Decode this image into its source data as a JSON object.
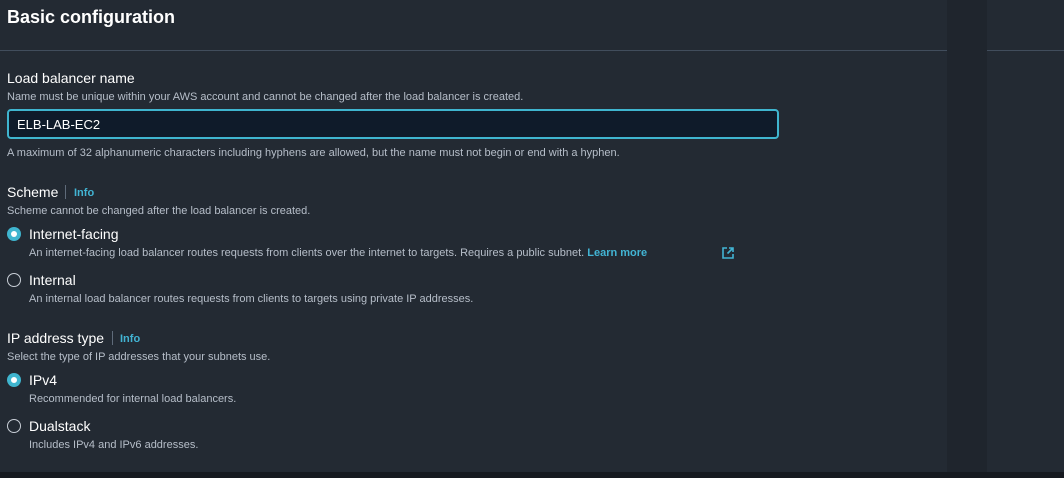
{
  "section": {
    "title": "Basic configuration"
  },
  "name_field": {
    "label": "Load balancer name",
    "description": "Name must be unique within your AWS account and cannot be changed after the load balancer is created.",
    "value": "ELB-LAB-EC2",
    "constraint": "A maximum of 32 alphanumeric characters including hyphens are allowed, but the name must not begin or end with a hyphen."
  },
  "scheme": {
    "label": "Scheme",
    "info": "Info",
    "description": "Scheme cannot be changed after the load balancer is created.",
    "options": [
      {
        "label": "Internet-facing",
        "description": "An internet-facing load balancer routes requests from clients over the internet to targets. Requires a public subnet.",
        "link": "Learn more",
        "selected": true
      },
      {
        "label": "Internal",
        "description": "An internal load balancer routes requests from clients to targets using private IP addresses.",
        "selected": false
      }
    ]
  },
  "ip_type": {
    "label": "IP address type",
    "info": "Info",
    "description": "Select the type of IP addresses that your subnets use.",
    "options": [
      {
        "label": "IPv4",
        "description": "Recommended for internal load balancers.",
        "selected": true
      },
      {
        "label": "Dualstack",
        "description": "Includes IPv4 and IPv6 addresses.",
        "selected": false
      }
    ]
  },
  "colors": {
    "accent": "#3fb5cf",
    "link": "#42b4d4",
    "panel": "#232a33"
  },
  "icons": {
    "external_link": "external-link-icon"
  }
}
